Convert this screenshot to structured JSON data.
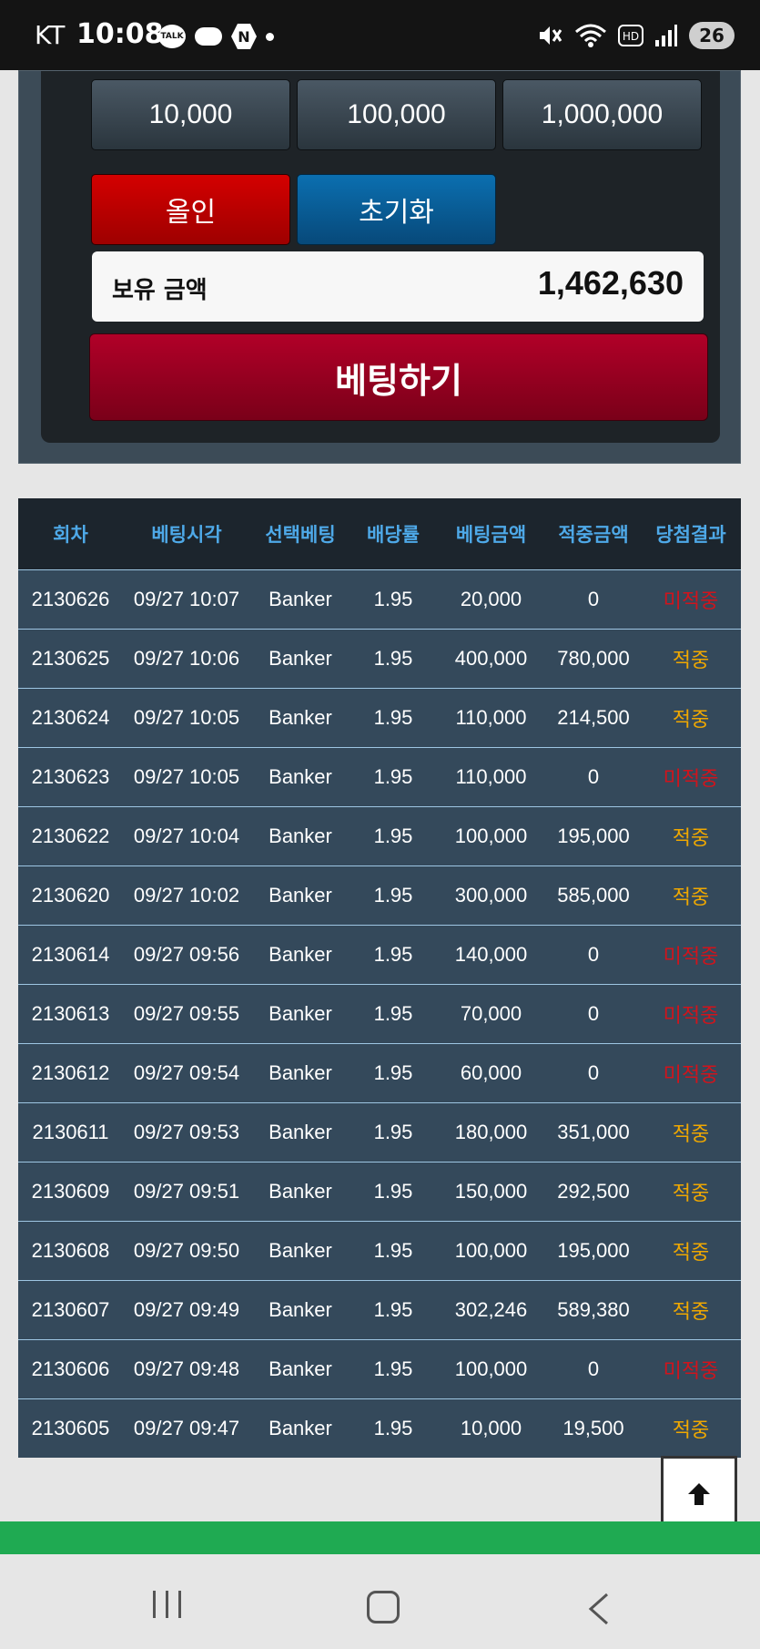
{
  "status_bar": {
    "carrier": "KT",
    "time": "10:08",
    "talk_badge": "TALK",
    "n_badge": "N",
    "battery": "26"
  },
  "bet_panel": {
    "chips": [
      "10,000",
      "100,000",
      "1,000,000"
    ],
    "allin_label": "올인",
    "reset_label": "초기화",
    "balance_label": "보유 금액",
    "balance_value": "1,462,630",
    "bet_button_label": "베팅하기"
  },
  "history_table": {
    "headers": [
      "회차",
      "베팅시각",
      "선택베팅",
      "배당률",
      "베팅금액",
      "적중금액",
      "당첨결과"
    ],
    "rows": [
      {
        "round": "2130626",
        "time": "09/27 10:07",
        "pick": "Banker",
        "odds": "1.95",
        "bet": "20,000",
        "win": "0",
        "result": "미적중",
        "hit": false
      },
      {
        "round": "2130625",
        "time": "09/27 10:06",
        "pick": "Banker",
        "odds": "1.95",
        "bet": "400,000",
        "win": "780,000",
        "result": "적중",
        "hit": true
      },
      {
        "round": "2130624",
        "time": "09/27 10:05",
        "pick": "Banker",
        "odds": "1.95",
        "bet": "110,000",
        "win": "214,500",
        "result": "적중",
        "hit": true
      },
      {
        "round": "2130623",
        "time": "09/27 10:05",
        "pick": "Banker",
        "odds": "1.95",
        "bet": "110,000",
        "win": "0",
        "result": "미적중",
        "hit": false
      },
      {
        "round": "2130622",
        "time": "09/27 10:04",
        "pick": "Banker",
        "odds": "1.95",
        "bet": "100,000",
        "win": "195,000",
        "result": "적중",
        "hit": true
      },
      {
        "round": "2130620",
        "time": "09/27 10:02",
        "pick": "Banker",
        "odds": "1.95",
        "bet": "300,000",
        "win": "585,000",
        "result": "적중",
        "hit": true
      },
      {
        "round": "2130614",
        "time": "09/27 09:56",
        "pick": "Banker",
        "odds": "1.95",
        "bet": "140,000",
        "win": "0",
        "result": "미적중",
        "hit": false
      },
      {
        "round": "2130613",
        "time": "09/27 09:55",
        "pick": "Banker",
        "odds": "1.95",
        "bet": "70,000",
        "win": "0",
        "result": "미적중",
        "hit": false
      },
      {
        "round": "2130612",
        "time": "09/27 09:54",
        "pick": "Banker",
        "odds": "1.95",
        "bet": "60,000",
        "win": "0",
        "result": "미적중",
        "hit": false
      },
      {
        "round": "2130611",
        "time": "09/27 09:53",
        "pick": "Banker",
        "odds": "1.95",
        "bet": "180,000",
        "win": "351,000",
        "result": "적중",
        "hit": true
      },
      {
        "round": "2130609",
        "time": "09/27 09:51",
        "pick": "Banker",
        "odds": "1.95",
        "bet": "150,000",
        "win": "292,500",
        "result": "적중",
        "hit": true
      },
      {
        "round": "2130608",
        "time": "09/27 09:50",
        "pick": "Banker",
        "odds": "1.95",
        "bet": "100,000",
        "win": "195,000",
        "result": "적중",
        "hit": true
      },
      {
        "round": "2130607",
        "time": "09/27 09:49",
        "pick": "Banker",
        "odds": "1.95",
        "bet": "302,246",
        "win": "589,380",
        "result": "적중",
        "hit": true
      },
      {
        "round": "2130606",
        "time": "09/27 09:48",
        "pick": "Banker",
        "odds": "1.95",
        "bet": "100,000",
        "win": "0",
        "result": "미적중",
        "hit": false
      },
      {
        "round": "2130605",
        "time": "09/27 09:47",
        "pick": "Banker",
        "odds": "1.95",
        "bet": "10,000",
        "win": "19,500",
        "result": "적중",
        "hit": true
      }
    ]
  },
  "colors": {
    "hit": "#f0a800",
    "miss": "#d0141c",
    "header_text": "#4ea9e8",
    "row_bg": "#34495b"
  }
}
